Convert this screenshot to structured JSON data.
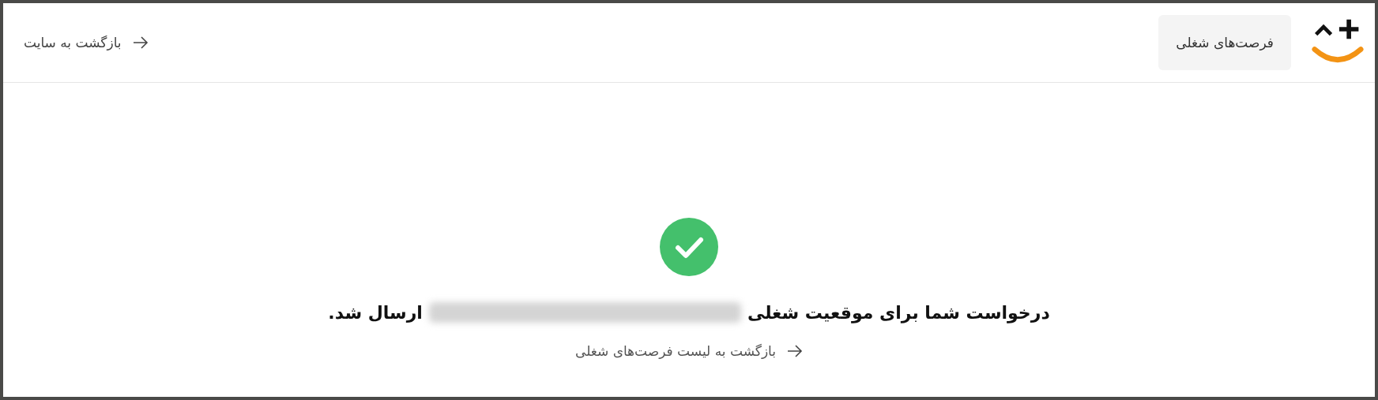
{
  "header": {
    "jobs_button": "فرصت‌های شغلی",
    "back_to_site": "بازگشت به سایت"
  },
  "confirmation": {
    "message_start": "درخواست شما برای موقعیت شغلی",
    "message_end": "ارسال شد.",
    "back_to_list": "بازگشت به لیست فرصت‌های شغلی"
  }
}
